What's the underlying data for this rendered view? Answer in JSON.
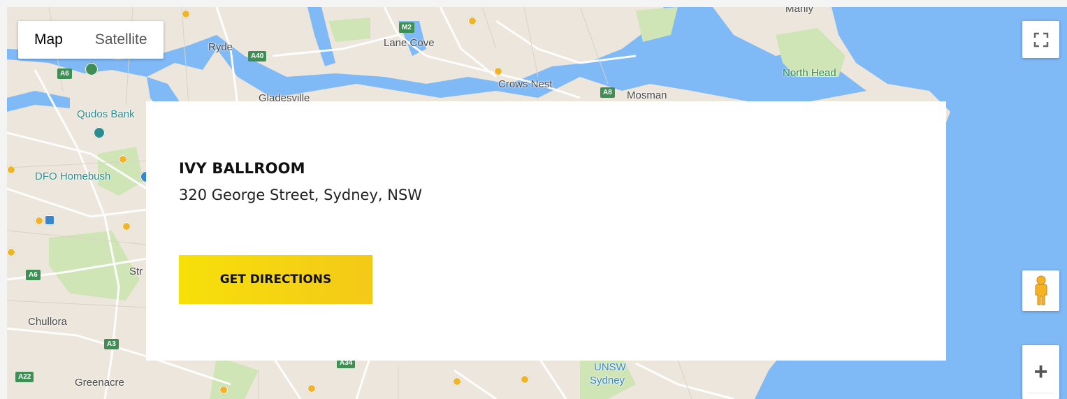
{
  "map": {
    "type_tabs": [
      {
        "label": "Map",
        "active": true
      },
      {
        "label": "Satellite",
        "active": false
      }
    ],
    "place_labels": [
      "Manly",
      "Lane Cove",
      "Ryde",
      "Crows Nest",
      "Mosman",
      "North Head",
      "Gladesville",
      "Qudos Bank",
      "DFO Homebush",
      "Str",
      "Chullora",
      "Greenacre",
      "UNSW",
      "Sydney"
    ],
    "road_shields": [
      "M2",
      "A40",
      "A6",
      "A8",
      "A6",
      "A3",
      "A22",
      "A34"
    ],
    "water_color": "#7fb9f6",
    "land_color": "#ede6dc",
    "park_color": "#cfe5b6"
  },
  "controls": {
    "fullscreen_icon": "fullscreen-icon",
    "pegman_icon": "pegman-icon",
    "zoom_in_label": "+"
  },
  "venue": {
    "name": "IVY BALLROOM",
    "address": "320 George Street, Sydney, NSW",
    "button_label": "GET DIRECTIONS",
    "button_color": "#f6e00a"
  }
}
